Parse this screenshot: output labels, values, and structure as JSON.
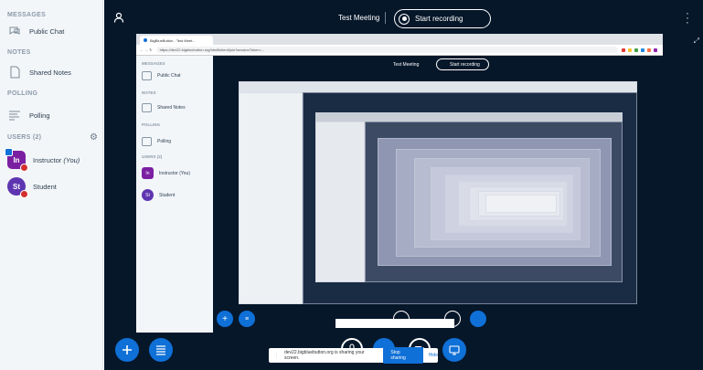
{
  "sidebar": {
    "messages_title": "MESSAGES",
    "public_chat": "Public Chat",
    "notes_title": "NOTES",
    "shared_notes": "Shared Notes",
    "polling_title": "POLLING",
    "polling": "Polling",
    "users_title": "USERS (2)",
    "users": [
      {
        "initials": "In",
        "name": "Instructor",
        "suffix": "(You)",
        "color": "#7b1fa2"
      },
      {
        "initials": "St",
        "name": "Student",
        "suffix": "",
        "color": "#5e35b1"
      }
    ]
  },
  "header": {
    "meeting_title": "Test Meeting",
    "record_label": "Start recording"
  },
  "screenshare": {
    "browser_tab": "BigBlueButton - Test Meet...",
    "url": "https://dev22.bigbluebutton.org/html5client/join?sessionToken=...",
    "inner_messages": "MESSAGES",
    "inner_public_chat": "Public Chat",
    "inner_notes": "NOTES",
    "inner_shared_notes": "Shared Notes",
    "inner_polling_title": "POLLING",
    "inner_polling": "Polling",
    "inner_users": "USERS (2)",
    "inner_instructor": "Instructor (You)",
    "inner_student": "Student",
    "inner_meeting": "Test Meeting",
    "inner_record": "Start recording"
  },
  "notice": {
    "text": "dev22.bigbluebutton.org is sharing your screen.",
    "stop": "Stop sharing",
    "hide": "Hide"
  },
  "icons": {
    "chat": "chat-icon",
    "notes": "notes-icon",
    "polling": "polling-icon",
    "gear": "gear-icon",
    "user": "user-icon",
    "more": "kebab-icon",
    "fullscreen": "fullscreen-icon",
    "plus": "plus-icon",
    "list": "list-icon",
    "mic": "mic-icon",
    "phone": "phone-icon",
    "video": "video-icon",
    "desktop": "desktop-share-icon"
  },
  "colors": {
    "main_bg": "#06172a",
    "accent": "#0f70d7",
    "sidebar_bg": "#f3f6f9"
  }
}
